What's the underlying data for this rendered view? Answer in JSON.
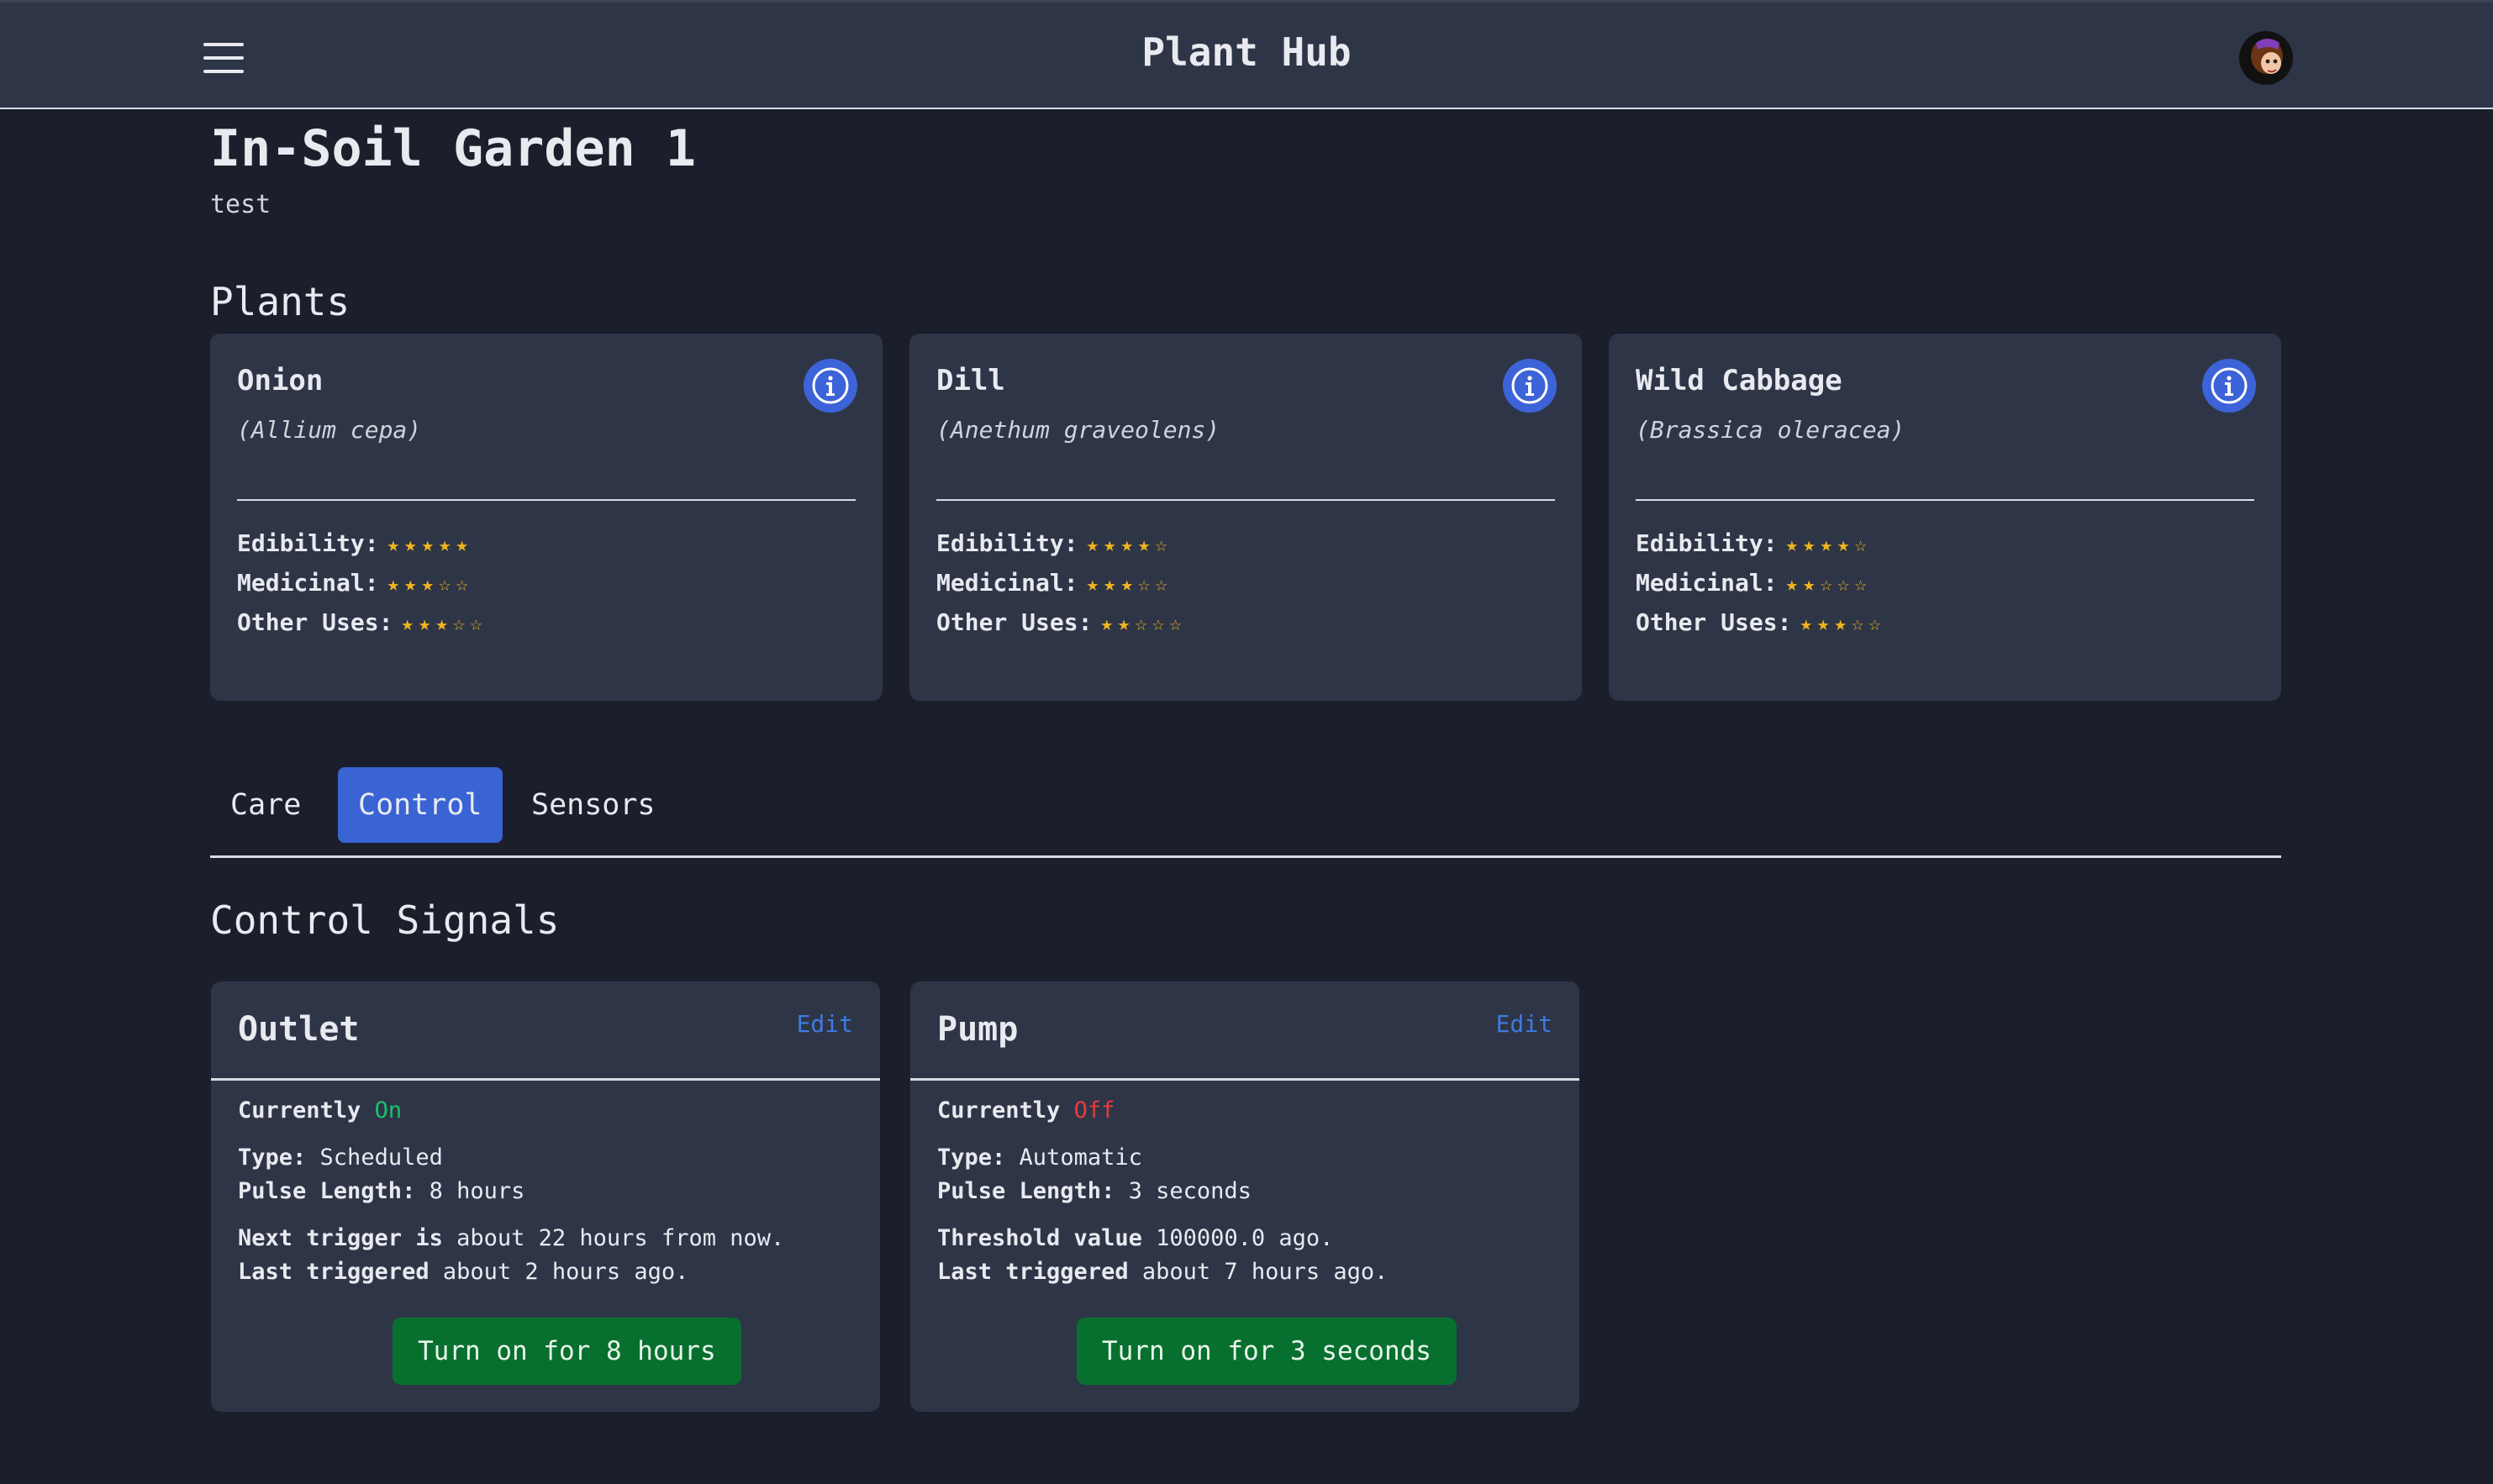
{
  "header": {
    "title": "Plant Hub",
    "menu_icon": "menu-icon",
    "avatar_icon": "user-avatar"
  },
  "garden": {
    "title": "In-Soil Garden 1",
    "subtitle": "test"
  },
  "plants_section": {
    "title": "Plants"
  },
  "rating_labels": {
    "edibility": "Edibility:",
    "medicinal": "Medicinal:",
    "other": "Other Uses:"
  },
  "plants": [
    {
      "name": "Onion",
      "scientific": "(Allium cepa)",
      "edibility": 5,
      "medicinal": 3,
      "other_uses": 3
    },
    {
      "name": "Dill",
      "scientific": "(Anethum graveolens)",
      "edibility": 4,
      "medicinal": 3,
      "other_uses": 2
    },
    {
      "name": "Wild Cabbage",
      "scientific": "(Brassica oleracea)",
      "edibility": 4,
      "medicinal": 2,
      "other_uses": 3
    }
  ],
  "tabs": [
    {
      "label": "Care",
      "active": false
    },
    {
      "label": "Control",
      "active": true
    },
    {
      "label": "Sensors",
      "active": false
    }
  ],
  "control_section": {
    "title": "Control Signals"
  },
  "signals": [
    {
      "title": "Outlet",
      "edit_label": "Edit",
      "currently_label": "Currently",
      "state": "On",
      "type_label": "Type:",
      "type": "Scheduled",
      "pulse_label": "Pulse Length:",
      "pulse": "8 hours",
      "line1_label": "Next trigger is",
      "line1_value": "about 22 hours from now.",
      "line2_label": "Last triggered",
      "line2_value": "about 2 hours ago.",
      "button_label": "Turn on for 8 hours"
    },
    {
      "title": "Pump",
      "edit_label": "Edit",
      "currently_label": "Currently",
      "state": "Off",
      "type_label": "Type:",
      "type": "Automatic",
      "pulse_label": "Pulse Length:",
      "pulse": "3 seconds",
      "line1_label": "Threshold value",
      "line1_value": "100000.0 ago.",
      "line2_label": "Last triggered",
      "line2_value": "about 7 hours ago.",
      "button_label": "Turn on for 3 seconds"
    }
  ],
  "colors": {
    "accent": "#3a63d4",
    "on": "#19c26a",
    "off": "#e73b3b",
    "star": "#f1b41f",
    "button": "#08702e"
  }
}
